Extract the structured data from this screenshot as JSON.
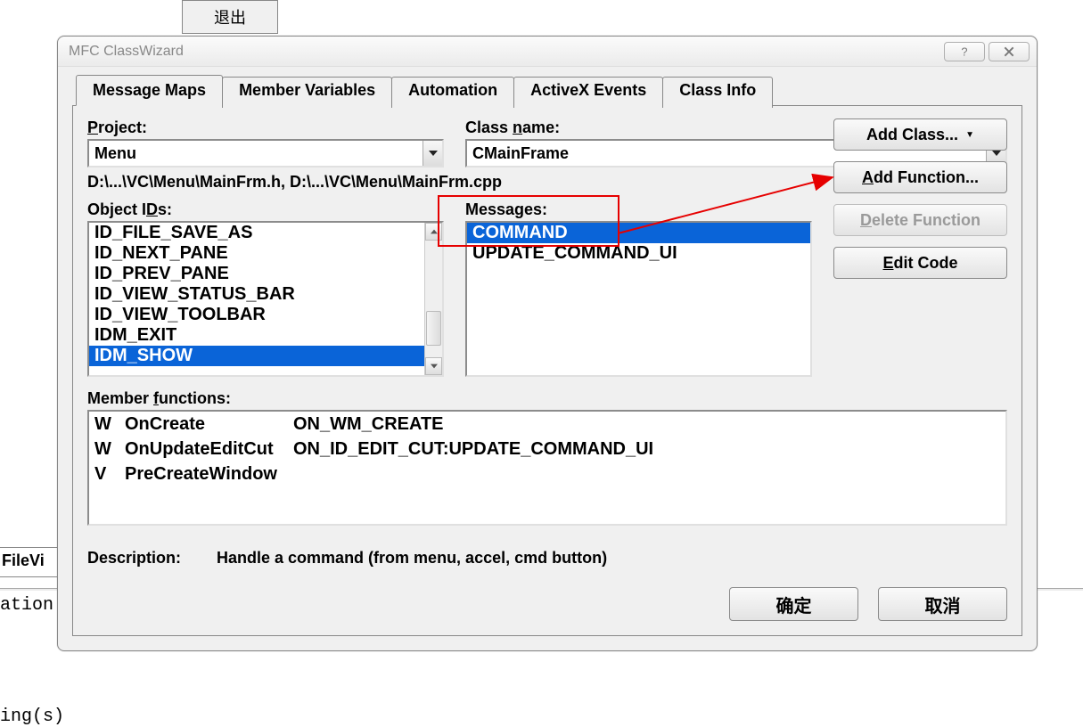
{
  "background": {
    "exit_button": "退出",
    "fileview": "FileVi",
    "ation": "ation:",
    "ings": "ing(s)"
  },
  "dialog": {
    "title": "MFC ClassWizard",
    "tabs": [
      "Message Maps",
      "Member Variables",
      "Automation",
      "ActiveX Events",
      "Class Info"
    ],
    "project_label_pre": "P",
    "project_label_post": "roject:",
    "project_value": "Menu",
    "classname_label_pre": "Class ",
    "classname_label_underline": "n",
    "classname_label_post": "ame:",
    "classname_value": "CMainFrame",
    "filepath": "D:\\...\\VC\\Menu\\MainFrm.h, D:\\...\\VC\\Menu\\MainFrm.cpp",
    "object_ids_label_pre": "Object I",
    "object_ids_label_under": "D",
    "object_ids_label_post": "s:",
    "object_ids": [
      "ID_FILE_SAVE_AS",
      "ID_NEXT_PANE",
      "ID_PREV_PANE",
      "ID_VIEW_STATUS_BAR",
      "ID_VIEW_TOOLBAR",
      "IDM_EXIT",
      "IDM_SHOW"
    ],
    "object_ids_selected": 6,
    "messages_label": "Messages:",
    "messages": [
      "COMMAND",
      "UPDATE_COMMAND_UI"
    ],
    "messages_selected": 0,
    "buttons": {
      "add_class": "Add Class...",
      "add_function_pre": "A",
      "add_function_post": "dd Function...",
      "delete_function_pre": "D",
      "delete_function_post": "elete Function",
      "edit_code_pre": "E",
      "edit_code_post": "dit Code"
    },
    "member_functions_label_pre": "Member ",
    "member_functions_label_under": "f",
    "member_functions_label_post": "unctions:",
    "member_functions": [
      {
        "marker": "W",
        "name": "OnCreate",
        "msg": "ON_WM_CREATE"
      },
      {
        "marker": "W",
        "name": "OnUpdateEditCut",
        "msg": "ON_ID_EDIT_CUT:UPDATE_COMMAND_UI"
      },
      {
        "marker": "V",
        "name": "PreCreateWindow",
        "msg": ""
      }
    ],
    "description_label": "Description:",
    "description_text": "Handle a command (from menu, accel, cmd button)",
    "ok": "确定",
    "cancel": "取消"
  }
}
